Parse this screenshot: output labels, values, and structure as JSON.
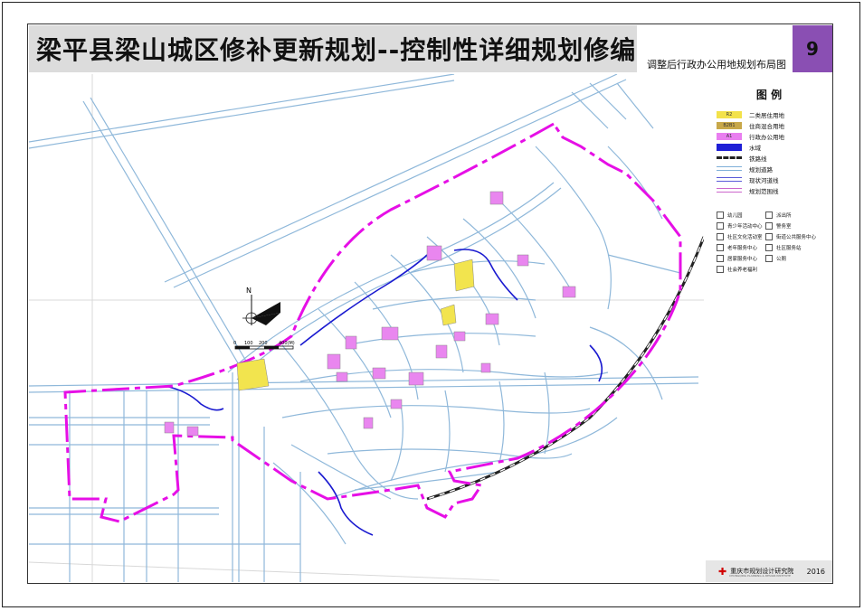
{
  "header": {
    "title": "梁平县梁山城区修补更新规划--控制性详细规划修编",
    "subtitle": "调整后行政办公用地规划布局图",
    "page_number": "9"
  },
  "legend": {
    "heading": "图 例",
    "items": [
      {
        "code": "R2",
        "label": "二类居住用地",
        "color": "#f3e24a"
      },
      {
        "code": "B2B1",
        "label": "住商混合用地",
        "color": "#c8a84a"
      },
      {
        "code": "A1",
        "label": "行政办公用地",
        "color": "#e97ef0"
      },
      {
        "code": "",
        "label": "水域",
        "color": "#1f1fd6"
      },
      {
        "code": "",
        "label": "铁路线",
        "color": "#222222"
      },
      {
        "code": "",
        "label": "规划道路",
        "color": "#7fb0d8"
      },
      {
        "code": "",
        "label": "现状河道线",
        "color": "#5a5ad8"
      },
      {
        "code": "",
        "label": "规划范围线",
        "color": "#cc66cc"
      }
    ],
    "facilities": [
      {
        "icon": "kindergarten-icon",
        "label": "幼儿园"
      },
      {
        "icon": "police-icon",
        "label": "派出所"
      },
      {
        "icon": "youth-center-icon",
        "label": "青少年活动中心"
      },
      {
        "icon": "police-station-icon",
        "label": "警务室"
      },
      {
        "icon": "community-culture-icon",
        "label": "社区文化活动室"
      },
      {
        "icon": "public-service-icon",
        "label": "街道公共服务中心"
      },
      {
        "icon": "elderly-center-icon",
        "label": "老年服务中心"
      },
      {
        "icon": "community-service-icon",
        "label": "社区服务站"
      },
      {
        "icon": "home-care-icon",
        "label": "居家服务中心"
      },
      {
        "icon": "toilet-icon",
        "label": "公厕"
      },
      {
        "icon": "social-welfare-icon",
        "label": "社会养老福利"
      }
    ]
  },
  "map": {
    "scale_labels": [
      "0",
      "100",
      "200",
      "400(M)"
    ],
    "north_label": "N"
  },
  "footer": {
    "org": "重庆市规划设计研究院",
    "org_en": "CHONGQING PLANNING & DESIGN INSTITUTE",
    "year": "2016"
  },
  "colors": {
    "boundary": "#e60fe6",
    "road": "#8fb8da",
    "water": "#1a1ad0",
    "admin": "#e986ef",
    "residential": "#f2e44e",
    "title_bar": "#dcdcdc",
    "page_badge": "#8a4fb3"
  }
}
